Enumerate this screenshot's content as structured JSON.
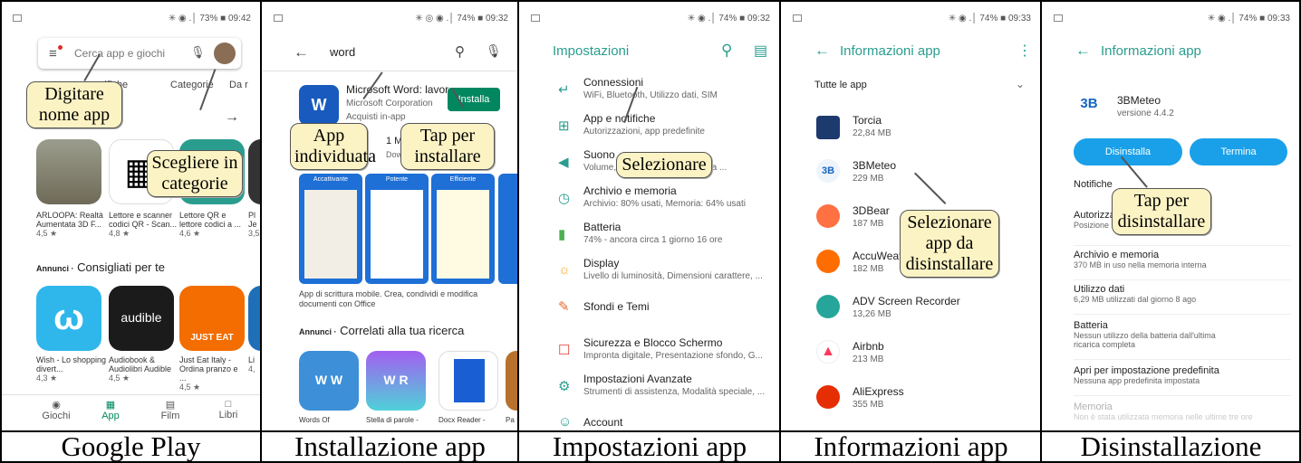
{
  "captions": [
    "Google Play",
    "Installazione app",
    "Impostazioni app",
    "Informazioni app",
    "Disinstallazione"
  ],
  "callouts": {
    "p1_search": "Digitare nome app",
    "p1_category": "Scegliere in categorie",
    "p2_found": "App individuata",
    "p2_tap": "Tap per installare",
    "p3_select": "Selezionare",
    "p4_select": "Selezionare app da disinstallare",
    "p5_tap": "Tap per disinstallare"
  },
  "p1": {
    "status": "✳ ◉ .│ 73% ■ 09:42",
    "search_placeholder": "Cerca app e giochi",
    "tabs": [
      "sifiche",
      "Categorie",
      "Da r"
    ],
    "apps_row1": [
      {
        "name": "ARLOOPA: Realtà Aumentata 3D F...",
        "rating": "4,5 ★"
      },
      {
        "name": "Lettore e scanner codici QR - Scan...",
        "rating": "4,8 ★"
      },
      {
        "name": "Lettore QR e lettore codici a ...",
        "rating": "4,6 ★"
      },
      {
        "name": "Pl Je",
        "rating": "3,5"
      }
    ],
    "section_prefix": "Annunci ·",
    "section_title": "Consigliati per te",
    "apps_row2": [
      {
        "name": "Wish - Lo shopping divert...",
        "rating": "4,3 ★"
      },
      {
        "name": "Audiobook & Audiolibri Audible",
        "rating": "4,5 ★"
      },
      {
        "name": "Just Eat Italy - Ordina pranzo e ...",
        "rating": "4,5 ★"
      },
      {
        "name": "Li",
        "rating": "4,"
      }
    ],
    "nav": [
      "Giochi",
      "App",
      "Film",
      "Libri"
    ],
    "audible_label": "audible",
    "justeat_label": "JUST EAT"
  },
  "p2": {
    "status": "✳ ◎ ◉ .│ 74% ■ 09:32",
    "query": "word",
    "app_name": "Microsoft Word: lavor..",
    "app_dev": "Microsoft Corporation",
    "app_note": "Acquisti in-app",
    "install": "Installa",
    "stats": "1 M",
    "stats2": "Dow",
    "shot_titles": [
      "Accattivante",
      "Potente",
      "Efficiente"
    ],
    "desc": "App di scrittura mobile. Crea, condividi e modifica documenti con Office",
    "section_prefix": "Annunci ·",
    "section_title": "Correlati alla tua ricerca",
    "related": [
      "Words Of",
      "Stella di parole -",
      "Docx Reader -",
      "Pa"
    ]
  },
  "p3": {
    "status": "✳ ◉ .│ 74% ■ 09:32",
    "title": "Impostazioni",
    "items": [
      {
        "t": "Connessioni",
        "s": "WiFi, Bluetooth, Utilizzo dati, SIM"
      },
      {
        "t": "App e notifiche",
        "s": "Autorizzazioni, app predefinite"
      },
      {
        "t": "Suono",
        "s": "Volume, Vibrazione, ... ra guidata ..."
      },
      {
        "t": "Archivio e memoria",
        "s": "Archivio: 80% usati, Memoria: 64% usati"
      },
      {
        "t": "Batteria",
        "s": "74% - ancora circa 1 giorno 16 ore"
      },
      {
        "t": "Display",
        "s": "Livello di luminosità, Dimensioni carattere, ..."
      },
      {
        "t": "Sfondi e Temi",
        "s": ""
      },
      {
        "t": "Sicurezza e Blocco Schermo",
        "s": "Impronta digitale, Presentazione sfondo, G..."
      },
      {
        "t": "Impostazioni Avanzate",
        "s": "Strumenti di assistenza, Modalità speciale, ..."
      },
      {
        "t": "Account",
        "s": ""
      }
    ]
  },
  "p4": {
    "status": "✳ ◉ .│ 74% ■ 09:33",
    "title": "Informazioni app",
    "filter": "Tutte le app",
    "apps": [
      {
        "t": "Torcia",
        "s": "22,84 MB"
      },
      {
        "t": "3BMeteo",
        "s": "229 MB"
      },
      {
        "t": "3DBear",
        "s": "187 MB"
      },
      {
        "t": "AccuWeath",
        "s": "182 MB"
      },
      {
        "t": "ADV Screen Recorder",
        "s": "13,26 MB"
      },
      {
        "t": "Airbnb",
        "s": "213 MB"
      },
      {
        "t": "AliExpress",
        "s": "355 MB"
      }
    ]
  },
  "p5": {
    "status": "✳ ◉ .│ 74% ■ 09:33",
    "title": "Informazioni app",
    "app_name": "3BMeteo",
    "version": "versione 4.4.2",
    "uninstall": "Disinstalla",
    "stop": "Termina",
    "notif": "Notifiche",
    "rows": [
      {
        "t": "Autorizza",
        "s": "Posizione"
      },
      {
        "t": "Archivio e memoria",
        "s": "370 MB in uso nella memoria interna"
      },
      {
        "t": "Utilizzo dati",
        "s": "6,29 MB utilizzati dal giorno 8 ago"
      },
      {
        "t": "Batteria",
        "s": "Nessun utilizzo della batteria dall'ultima ricarica completa"
      },
      {
        "t": "Apri per impostazione predefinita",
        "s": "Nessuna app predefinita impostata"
      },
      {
        "t": "Memoria",
        "s": "Non è stata utilizzata memoria nelle ultime tre ore"
      }
    ]
  }
}
